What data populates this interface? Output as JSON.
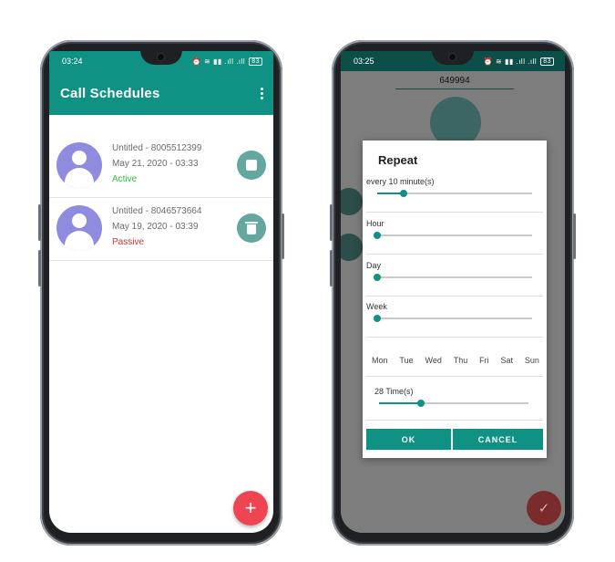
{
  "left_phone": {
    "status_time": "03:24",
    "status_icons": "⏰ ≋ ▮▮ .ıll .ıll",
    "battery": "83",
    "app_title": "Call Schedules",
    "schedules": [
      {
        "name": "Untitled - 8005512399",
        "date": "May 21, 2020 - 03:33",
        "status": "Active",
        "action_icon": "stop-icon"
      },
      {
        "name": "Untitled - 8046573664",
        "date": "May 19, 2020 - 03:39",
        "status": "Passive",
        "action_icon": "delete-icon"
      }
    ],
    "fab_label": "+"
  },
  "right_phone": {
    "status_time": "03:25",
    "status_icons": "⏰ ≋ ▮▮ .ıll .ıll",
    "battery": "83",
    "behind_number": "649994",
    "dialog": {
      "title": "Repeat",
      "sliders": [
        {
          "label": "every 10 minute(s)",
          "value": 0.17
        },
        {
          "label": "Hour",
          "value": 0.0
        },
        {
          "label": "Day",
          "value": 0.0
        },
        {
          "label": "Week",
          "value": 0.0
        }
      ],
      "days": [
        "Mon",
        "Tue",
        "Wed",
        "Thu",
        "Fri",
        "Sat",
        "Sun"
      ],
      "times": {
        "label": "28 Time(s)",
        "value": 0.28
      },
      "ok_label": "OK",
      "cancel_label": "CANCEL"
    },
    "fab_label": "✓"
  },
  "colors": {
    "primary": "#0f9183",
    "fab": "#ef4452",
    "avatar": "#8f8ce0",
    "active": "#2fbf3b",
    "passive": "#d83434"
  }
}
